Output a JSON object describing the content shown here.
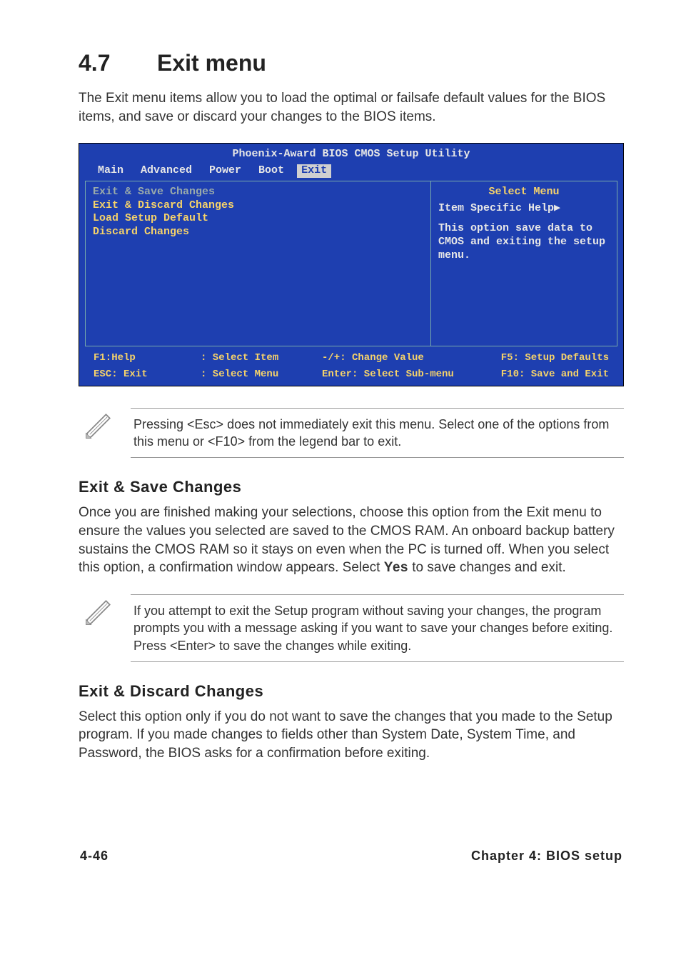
{
  "section": {
    "number": "4.7",
    "title": "Exit menu"
  },
  "intro": "The Exit menu items allow you to load the optimal or failsafe default values for the BIOS items, and save or discard your changes to the BIOS items.",
  "bios": {
    "title": "Phoenix-Award BIOS CMOS Setup Utility",
    "tabs": [
      "Main",
      "Advanced",
      "Power",
      "Boot",
      "Exit"
    ],
    "active_tab": "Exit",
    "menu": {
      "selected": "Exit & Save Changes",
      "items": [
        "Exit & Discard Changes",
        "Load Setup Default",
        "Discard Changes"
      ]
    },
    "help": {
      "title": "Select Menu",
      "head": "Item Specific Help▶",
      "text": "This option save data to CMOS and exiting the setup menu."
    },
    "legend": {
      "row1": {
        "c1": "F1:Help",
        "c2": ": Select Item",
        "c3": "-/+: Change Value",
        "c4": "F5: Setup Defaults"
      },
      "row2": {
        "c1": "ESC: Exit",
        "c2": ": Select Menu",
        "c3": "Enter: Select Sub-menu",
        "c4": "F10: Save and Exit"
      }
    }
  },
  "note1": "Pressing <Esc> does not immediately exit this menu. Select one of the options from this menu or <F10> from the legend bar to exit.",
  "h_save": "Exit & Save Changes",
  "p_save_a": "Once you are finished making your selections, choose this option from the Exit menu to ensure the values you selected are saved to the CMOS RAM. An onboard backup battery sustains the CMOS RAM so it stays on even when the PC is turned off. When you select this option, a confirmation window appears. Select ",
  "p_save_bold": "Yes",
  "p_save_b": " to save changes and exit.",
  "note2": " If you attempt to exit the Setup program without saving your changes, the program prompts you with a message asking if you want to save your changes before exiting. Press <Enter>  to save the  changes while exiting.",
  "h_discard": "Exit & Discard Changes",
  "p_discard": "Select this option only if you do not want to save the changes that you made to the Setup program. If you made changes to fields other than System Date, System Time, and Password, the BIOS asks for a confirmation before exiting.",
  "footer": {
    "left": "4-46",
    "right": "Chapter 4: BIOS setup"
  }
}
